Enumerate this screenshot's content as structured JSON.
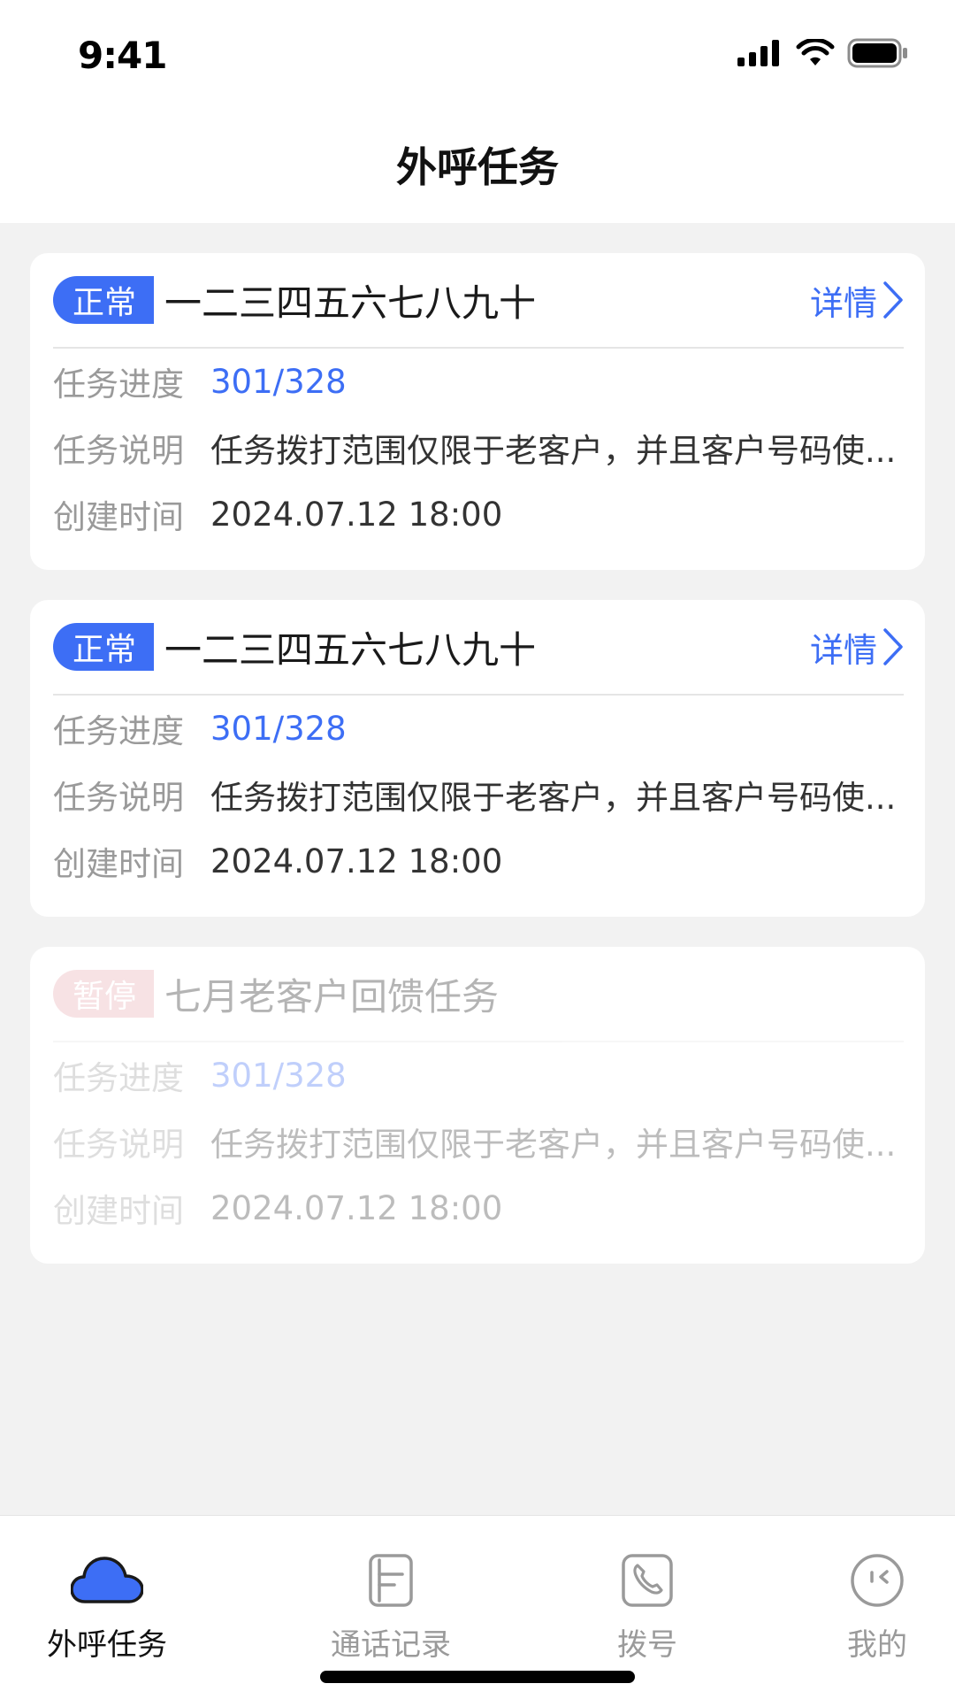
{
  "status_bar": {
    "time": "9:41"
  },
  "header": {
    "title": "外呼任务"
  },
  "tasks": [
    {
      "status": "正常",
      "title": "一二三四五六七八九十",
      "detail_label": "详情",
      "progress_label": "任务进度",
      "progress": "301/328",
      "desc_label": "任务说明",
      "description": "任务拨打范围仅限于老客户，并且客户号码使...",
      "created_label": "创建时间",
      "created": "2024.07.12 18:00"
    },
    {
      "status": "正常",
      "title": "一二三四五六七八九十",
      "detail_label": "详情",
      "progress_label": "任务进度",
      "progress": "301/328",
      "desc_label": "任务说明",
      "description": "任务拨打范围仅限于老客户，并且客户号码使...",
      "created_label": "创建时间",
      "created": "2024.07.12 18:00"
    },
    {
      "status": "暂停",
      "title": "七月老客户回馈任务",
      "progress_label": "任务进度",
      "progress": "301/328",
      "desc_label": "任务说明",
      "description": "任务拨打范围仅限于老客户，并且客户号码使...",
      "created_label": "创建时间",
      "created": "2024.07.12 18:00"
    }
  ],
  "tab_bar": {
    "active": "外呼任务",
    "items": [
      {
        "label": "外呼任务",
        "icon": "cloud-icon"
      },
      {
        "label": "通话记录",
        "icon": "call-log-icon"
      },
      {
        "label": "拨号",
        "icon": "phone-icon"
      },
      {
        "label": "我的",
        "icon": "profile-face-icon"
      }
    ]
  },
  "colors": {
    "accent": "#3d6ef5",
    "normal_badge": "#3d6ef5",
    "paused_badge": "#e9a7ac",
    "background": "#f2f2f2"
  }
}
